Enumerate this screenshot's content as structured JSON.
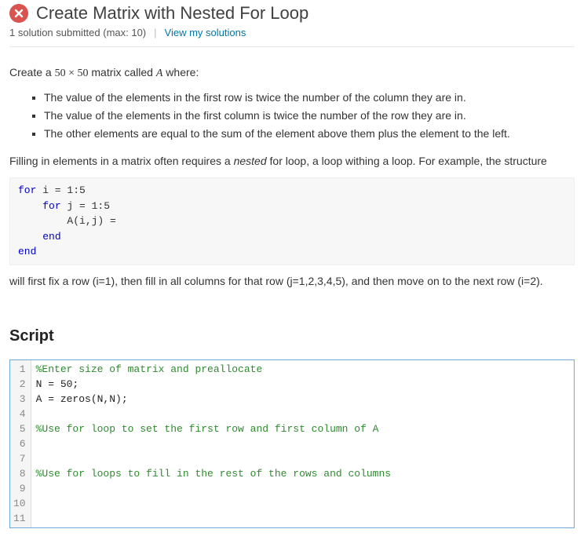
{
  "header": {
    "status": "error",
    "title": "Create Matrix with Nested For Loop",
    "submission_text": "1 solution submitted (max: 10)",
    "view_link": "View my solutions"
  },
  "problem": {
    "intro_pre": "Create a ",
    "matrix_size": "50 × 50",
    "intro_mid": " matrix called ",
    "matrix_name": "A",
    "intro_post": " where:",
    "bullets": [
      "The value of the elements in the first row is twice the number of the column they are in.",
      "The value of the elements in the first column is twice the number of the row they are in.",
      "The other elements are equal to the sum of the element above them plus the element to the left."
    ],
    "nested_pre": "Filling in elements in a matrix often requires a ",
    "nested_em": "nested",
    "nested_post": " for loop, a loop withing a loop. For example, the structure",
    "code_tokens": [
      {
        "t": "kw",
        "v": "for"
      },
      {
        "t": "pl",
        "v": " i = 1:5\n    "
      },
      {
        "t": "kw",
        "v": "for"
      },
      {
        "t": "pl",
        "v": " j = 1:5\n        A(i,j) = \n    "
      },
      {
        "t": "kw",
        "v": "end"
      },
      {
        "t": "pl",
        "v": "\n"
      },
      {
        "t": "kw",
        "v": "end"
      }
    ],
    "closing": "will first fix a row (i=1), then fill in all columns for that row (j=1,2,3,4,5), and then move on to the next row (i=2)."
  },
  "script": {
    "heading": "Script",
    "lines": [
      {
        "n": 1,
        "cls": "cm",
        "text": "%Enter size of matrix and preallocate"
      },
      {
        "n": 2,
        "cls": "pl",
        "text": "N = 50;"
      },
      {
        "n": 3,
        "cls": "pl",
        "text": "A = zeros(N,N);"
      },
      {
        "n": 4,
        "cls": "pl",
        "text": ""
      },
      {
        "n": 5,
        "cls": "cm",
        "text": "%Use for loop to set the first row and first column of A"
      },
      {
        "n": 6,
        "cls": "pl",
        "text": ""
      },
      {
        "n": 7,
        "cls": "pl",
        "text": ""
      },
      {
        "n": 8,
        "cls": "cm",
        "text": "%Use for loops to fill in the rest of the rows and columns"
      },
      {
        "n": 9,
        "cls": "pl",
        "text": ""
      },
      {
        "n": 10,
        "cls": "pl",
        "text": ""
      },
      {
        "n": 11,
        "cls": "pl",
        "text": ""
      }
    ]
  }
}
